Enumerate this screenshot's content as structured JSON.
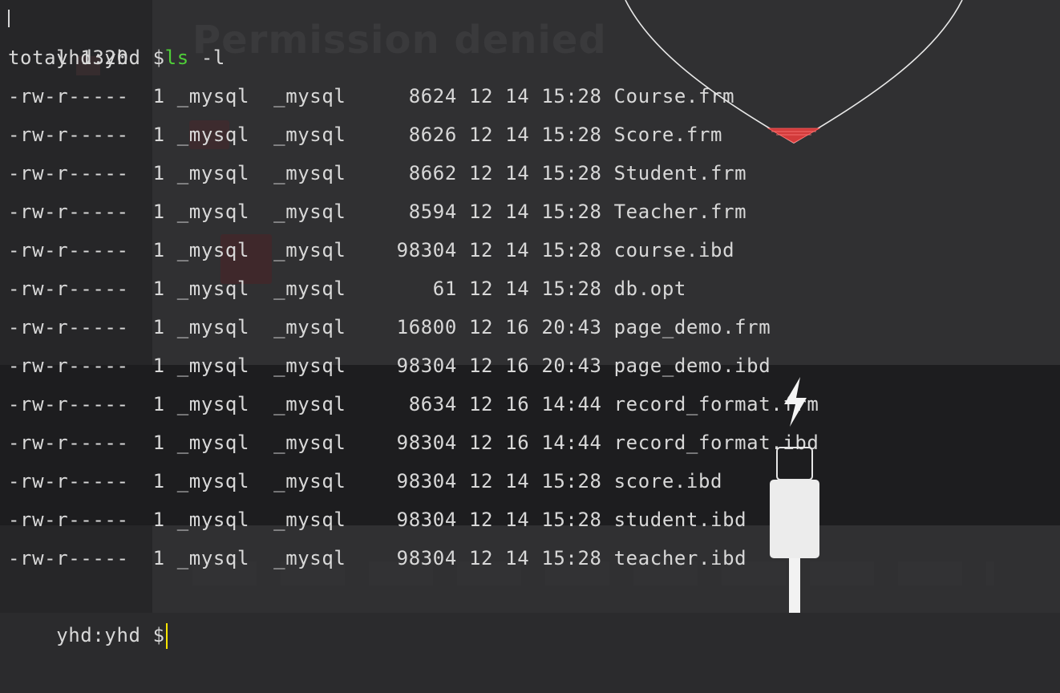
{
  "terminal": {
    "prompt": "yhd:yhd $",
    "command": {
      "name": "ls",
      "args": " -l"
    },
    "total_line": "total 1320",
    "files": [
      {
        "perm": "-rw-r-----",
        "links": "1",
        "owner": "_mysql",
        "group": "_mysql",
        "size": "8624",
        "month": "12",
        "day": "14",
        "time": "15:28",
        "name": "Course.frm"
      },
      {
        "perm": "-rw-r-----",
        "links": "1",
        "owner": "_mysql",
        "group": "_mysql",
        "size": "8626",
        "month": "12",
        "day": "14",
        "time": "15:28",
        "name": "Score.frm"
      },
      {
        "perm": "-rw-r-----",
        "links": "1",
        "owner": "_mysql",
        "group": "_mysql",
        "size": "8662",
        "month": "12",
        "day": "14",
        "time": "15:28",
        "name": "Student.frm"
      },
      {
        "perm": "-rw-r-----",
        "links": "1",
        "owner": "_mysql",
        "group": "_mysql",
        "size": "8594",
        "month": "12",
        "day": "14",
        "time": "15:28",
        "name": "Teacher.frm"
      },
      {
        "perm": "-rw-r-----",
        "links": "1",
        "owner": "_mysql",
        "group": "_mysql",
        "size": "98304",
        "month": "12",
        "day": "14",
        "time": "15:28",
        "name": "course.ibd"
      },
      {
        "perm": "-rw-r-----",
        "links": "1",
        "owner": "_mysql",
        "group": "_mysql",
        "size": "61",
        "month": "12",
        "day": "14",
        "time": "15:28",
        "name": "db.opt"
      },
      {
        "perm": "-rw-r-----",
        "links": "1",
        "owner": "_mysql",
        "group": "_mysql",
        "size": "16800",
        "month": "12",
        "day": "16",
        "time": "20:43",
        "name": "page_demo.frm"
      },
      {
        "perm": "-rw-r-----",
        "links": "1",
        "owner": "_mysql",
        "group": "_mysql",
        "size": "98304",
        "month": "12",
        "day": "16",
        "time": "20:43",
        "name": "page_demo.ibd"
      },
      {
        "perm": "-rw-r-----",
        "links": "1",
        "owner": "_mysql",
        "group": "_mysql",
        "size": "8634",
        "month": "12",
        "day": "16",
        "time": "14:44",
        "name": "record_format.frm"
      },
      {
        "perm": "-rw-r-----",
        "links": "1",
        "owner": "_mysql",
        "group": "_mysql",
        "size": "98304",
        "month": "12",
        "day": "16",
        "time": "14:44",
        "name": "record_format.ibd"
      },
      {
        "perm": "-rw-r-----",
        "links": "1",
        "owner": "_mysql",
        "group": "_mysql",
        "size": "98304",
        "month": "12",
        "day": "14",
        "time": "15:28",
        "name": "score.ibd"
      },
      {
        "perm": "-rw-r-----",
        "links": "1",
        "owner": "_mysql",
        "group": "_mysql",
        "size": "98304",
        "month": "12",
        "day": "14",
        "time": "15:28",
        "name": "student.ibd"
      },
      {
        "perm": "-rw-r-----",
        "links": "1",
        "owner": "_mysql",
        "group": "_mysql",
        "size": "98304",
        "month": "12",
        "day": "14",
        "time": "15:28",
        "name": "teacher.ibd"
      }
    ],
    "colors": {
      "background": "#2b2b2d",
      "text": "#d8d8d8",
      "command": "#4fcf38",
      "cursor": "#ffe600"
    }
  },
  "wallpaper": {
    "ghost_text": "Permission denied",
    "icons": [
      "heart-outline-icon",
      "lightning-bolt-icon",
      "charging-cable-icon"
    ]
  }
}
